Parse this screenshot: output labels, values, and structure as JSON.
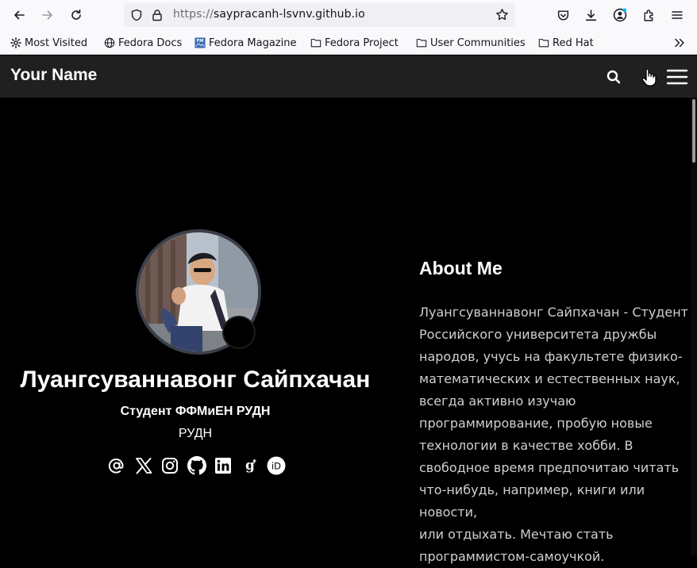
{
  "browser": {
    "url_scheme": "https://",
    "url_host": "saypracanh-lsvnv.github.io",
    "bookmarks": [
      {
        "label": "Most Visited",
        "icon": "gear-icon"
      },
      {
        "label": "Fedora Docs",
        "icon": "globe-icon"
      },
      {
        "label": "Fedora Magazine",
        "icon": "fm-icon"
      },
      {
        "label": "Fedora Project",
        "icon": "folder-icon"
      },
      {
        "label": "User Communities",
        "icon": "folder-icon"
      },
      {
        "label": "Red Hat",
        "icon": "folder-icon"
      }
    ]
  },
  "site": {
    "title": "Your Name"
  },
  "profile": {
    "name": "Луангсуваннавонг Сайпхачан",
    "role": "Студент ФФМиЕН РУДН",
    "affiliation": "РУДН",
    "socials": [
      "email-icon",
      "x-icon",
      "instagram-icon",
      "github-icon",
      "linkedin-icon",
      "google-scholar-icon",
      "orcid-icon"
    ]
  },
  "about": {
    "title": "About Me",
    "text": "Луангсуваннавонг Сайпхачан - Студент\nРоссийского университета дружбы\nнародов, учусь на факультете физико-\nматематических и естественных наук,\nвсегда активно изучаю\nпрограммирование, пробую новые\nтехнологии в качестве хобби. В\nсвободное время предпочитаю читать\nчто-нибудь, например, книги или новости,\nили отдыхать. Мечтаю стать\nпрограммистом-самоучкой."
  }
}
